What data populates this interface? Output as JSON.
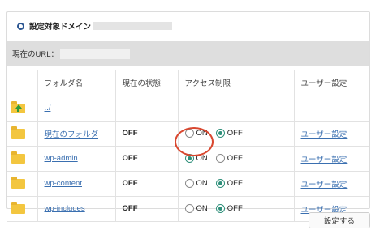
{
  "domain": {
    "label": "設定対象ドメイン"
  },
  "url_bar": {
    "label": "現在のURL："
  },
  "table": {
    "headers": {
      "name": "フォルダ名",
      "state": "現在の状態",
      "access": "アクセス制限",
      "user": "ユーザー設定"
    },
    "rows": [
      {
        "icon": "parent-folder-icon",
        "name": "../"
      },
      {
        "icon": "folder-icon",
        "name": "現在のフォルダ",
        "state": "OFF",
        "on_label": "ON",
        "off_label": "OFF",
        "selected": "OFF",
        "user_link": "ユーザー設定"
      },
      {
        "icon": "folder-icon",
        "name": "wp-admin",
        "state": "OFF",
        "on_label": "ON",
        "off_label": "OFF",
        "selected": "ON",
        "user_link": "ユーザー設定"
      },
      {
        "icon": "folder-icon",
        "name": "wp-content",
        "state": "OFF",
        "on_label": "ON",
        "off_label": "OFF",
        "selected": "OFF",
        "user_link": "ユーザー設定"
      },
      {
        "icon": "folder-icon",
        "name": "wp-includes",
        "state": "OFF",
        "on_label": "ON",
        "off_label": "OFF",
        "selected": "OFF",
        "user_link": "ユーザー設定"
      }
    ]
  },
  "submit_label": "設定する",
  "colors": {
    "accent": "#2e8f7a",
    "link": "#3a6fb0",
    "highlight": "#d9472f",
    "folder": "#f3c63f"
  }
}
